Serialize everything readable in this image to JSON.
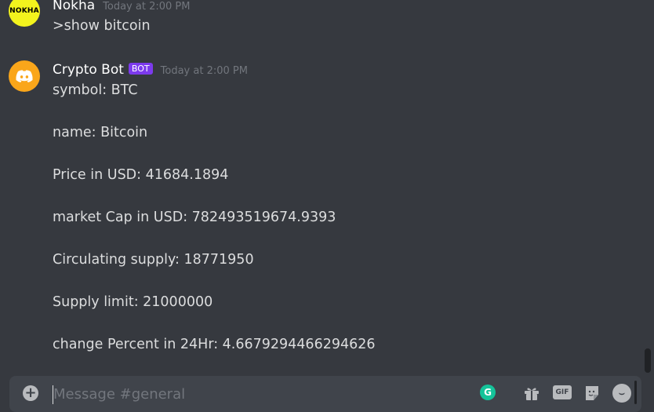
{
  "messages": [
    {
      "username": "Nokha",
      "avatar_text": "NOKHA",
      "timestamp": "Today at 2:00 PM",
      "lines": [
        ">show bitcoin"
      ]
    },
    {
      "username": "Crypto Bot",
      "badge": "BOT",
      "timestamp": "Today at 2:00 PM",
      "avatar_icon": "discord-logo-icon",
      "lines": [
        "symbol: BTC",
        "name: Bitcoin",
        "Price in USD: 41684.1894",
        "market Cap in USD: 782493519674.9393",
        "Circulating supply: 18771950",
        "Supply limit: 21000000",
        "change Percent in 24Hr: 4.6679294466294626"
      ]
    }
  ],
  "composer": {
    "placeholder": "Message #general",
    "gif_label": "GIF",
    "icons": [
      "add-attachment-icon",
      "grammarly-icon",
      "gift-icon",
      "gif-icon",
      "sticker-icon",
      "emoji-icon"
    ]
  },
  "colors": {
    "background": "#36393f",
    "composer_bg": "#40444b",
    "bot_badge": "#7c3aed",
    "bot_avatar": "#faa61a",
    "user_avatar": "#f3f31d",
    "grammarly": "#15c39a"
  }
}
